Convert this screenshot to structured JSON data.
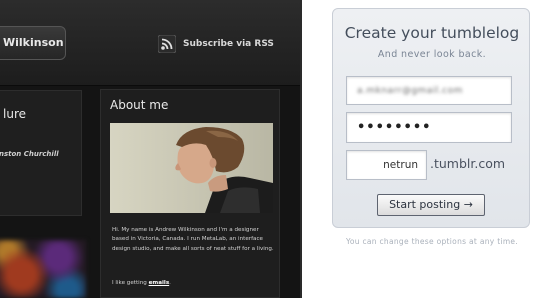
{
  "theme_preview": {
    "header": {
      "name_tab": "Wilkinson",
      "rss_label": "Subscribe via RSS"
    },
    "featured": {
      "title": "lure",
      "author": "nston Churchill"
    },
    "about": {
      "title": "About me",
      "bio": "Hi. My name is Andrew Wilkinson and I'm a designer based in Victoria, Canada. I run MetaLab, an interface design studio, and make all sorts of neat stuff for a living.",
      "getting_prefix": "I like getting ",
      "getting_link": "emails",
      "getting_suffix": "."
    }
  },
  "signup": {
    "title": "Create your tumblelog",
    "subtitle": "And never look back.",
    "email_value": "a.mknarr@gmail.com",
    "password_value": "••••••••",
    "url_value": "netrun",
    "url_suffix": ".tumblr.com",
    "submit_label": "Start posting →",
    "help_text": "You can change these options at any time."
  },
  "colors": {
    "theme_background": "#141414",
    "card_background": "#e6e9ee",
    "title_color": "#444e5c"
  },
  "icons": {
    "rss": "rss-icon"
  }
}
